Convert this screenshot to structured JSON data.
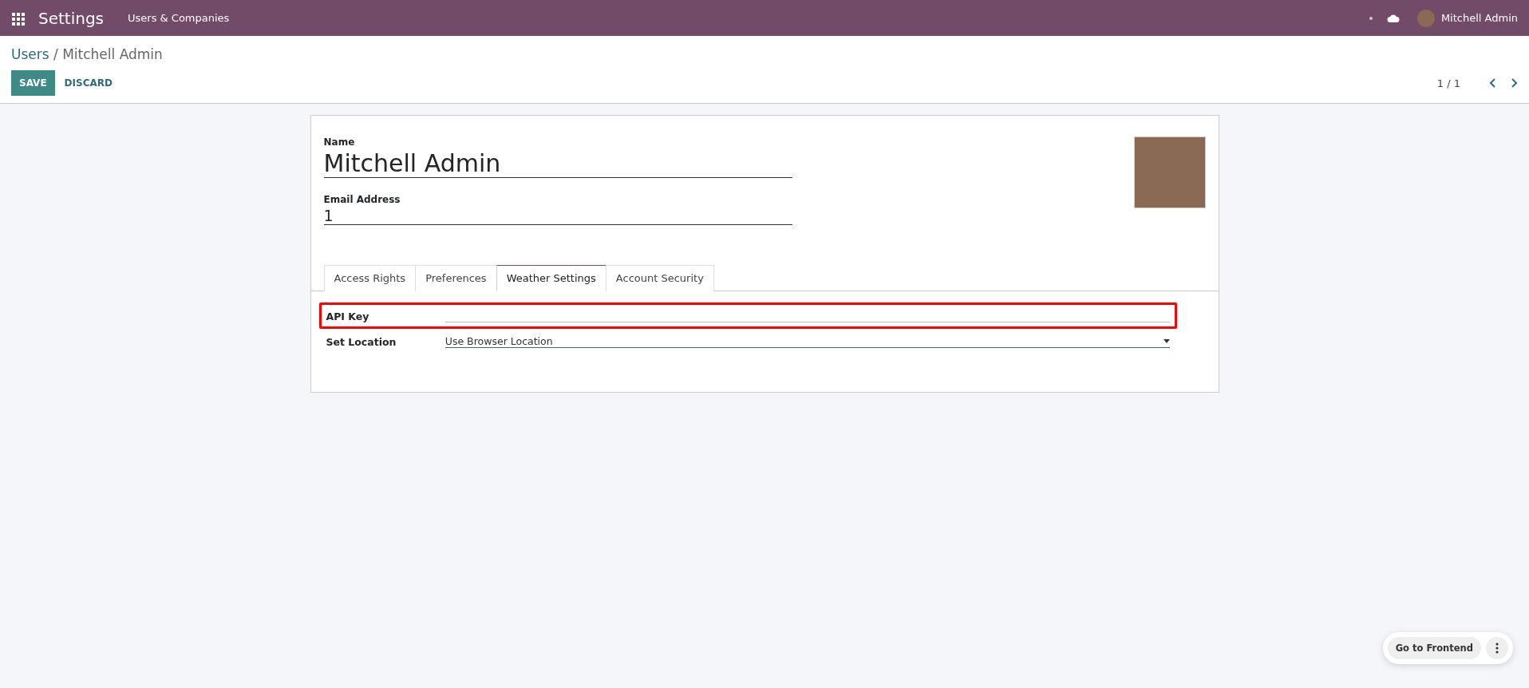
{
  "navbar": {
    "app_title": "Settings",
    "menu": [
      "Users & Companies"
    ],
    "user": "Mitchell Admin"
  },
  "breadcrumb": {
    "parent": "Users",
    "separator": "/",
    "current": "Mitchell Admin"
  },
  "actions": {
    "save": "SAVE",
    "discard": "DISCARD"
  },
  "pager": {
    "value": "1 / 1"
  },
  "form": {
    "name_label": "Name",
    "name_value": "Mitchell Admin",
    "email_label": "Email Address",
    "email_value": "1",
    "tabs": [
      {
        "label": "Access Rights",
        "selected": false
      },
      {
        "label": "Preferences",
        "selected": false
      },
      {
        "label": "Weather Settings",
        "selected": true
      },
      {
        "label": "Account Security",
        "selected": false
      }
    ],
    "fields": [
      {
        "kind": "input",
        "label": "API Key",
        "highlighted": true
      },
      {
        "kind": "select",
        "label": "Set Location",
        "value": "Use Browser Location",
        "highlighted": false
      }
    ]
  },
  "floating": {
    "button": "Go to Frontend"
  }
}
